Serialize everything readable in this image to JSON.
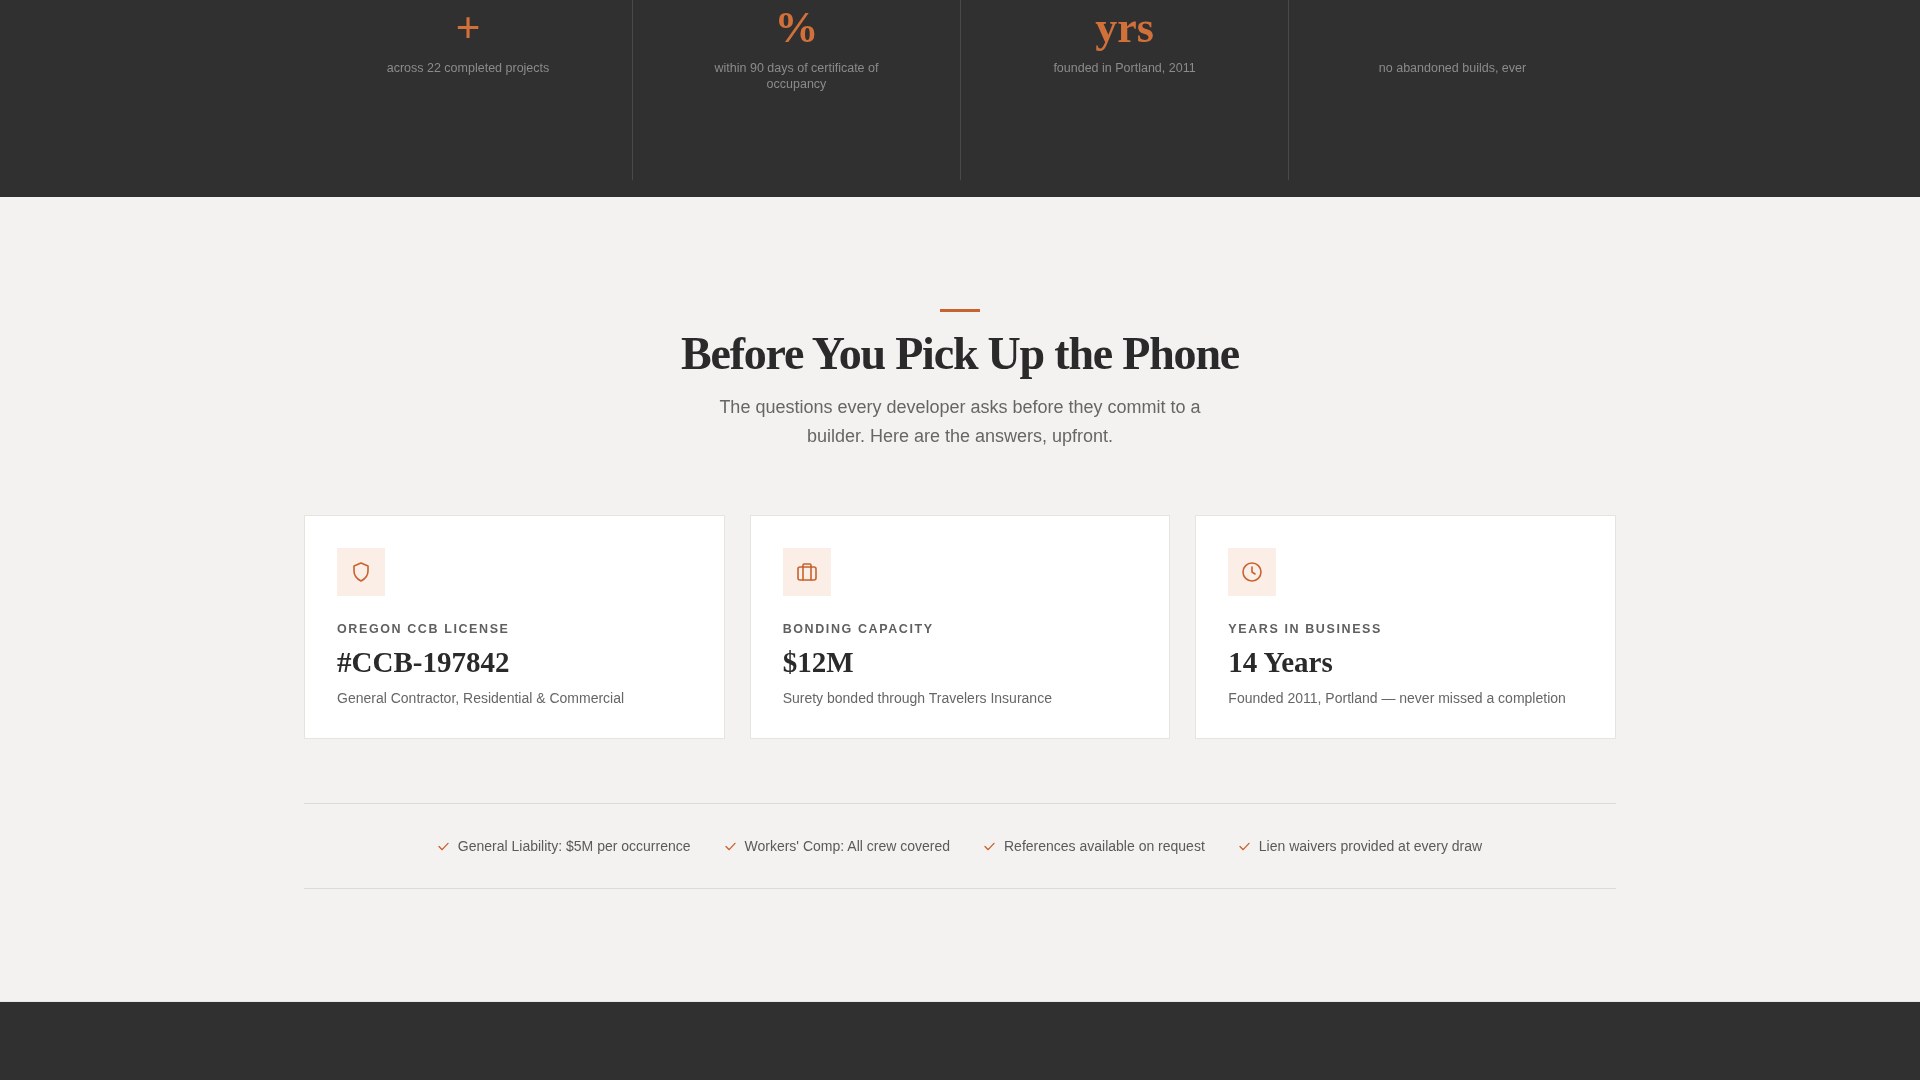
{
  "stats": [
    {
      "value": "+",
      "caption": "across 22 completed projects"
    },
    {
      "value": "%",
      "caption": "within 90 days of certificate of occupancy"
    },
    {
      "value": "yrs",
      "caption": "founded in Portland, 2011"
    },
    {
      "caption": "no abandoned builds, ever"
    }
  ],
  "section": {
    "heading": "Before You Pick Up the Phone",
    "subtitle": "The questions every developer asks before they commit to a builder. Here are the answers, upfront."
  },
  "cards": [
    {
      "label": "OREGON CCB LICENSE",
      "value": "#CCB-197842",
      "description": "General Contractor, Residential & Commercial"
    },
    {
      "label": "BONDING CAPACITY",
      "value": "$12M",
      "description": "Surety bonded through Travelers Insurance"
    },
    {
      "label": "YEARS IN BUSINESS",
      "value": "14 Years",
      "description": "Founded 2011, Portland — never missed a completion"
    }
  ],
  "assurances": [
    "General Liability: $5M per occurrence",
    "Workers' Comp: All crew covered",
    "References available on request",
    "Lien waivers provided at every draw"
  ]
}
